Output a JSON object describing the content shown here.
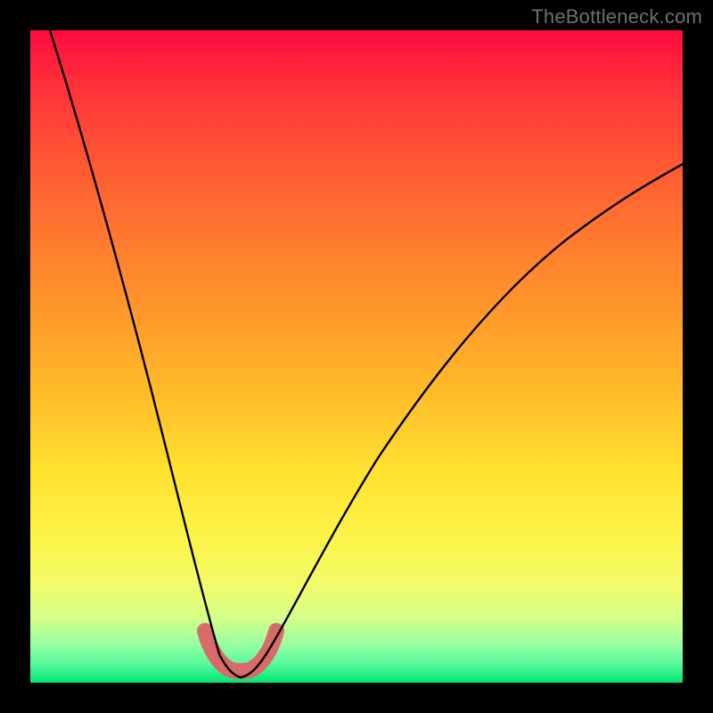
{
  "watermark": "TheBottleneck.com",
  "chart_data": {
    "type": "line",
    "title": "",
    "xlabel": "",
    "ylabel": "",
    "xlim": [
      0,
      100
    ],
    "ylim": [
      0,
      100
    ],
    "grid": false,
    "legend": false,
    "series": [
      {
        "name": "curve-left",
        "x": [
          0,
          4,
          8,
          12,
          15,
          18,
          21,
          23,
          25,
          27,
          28,
          29,
          30
        ],
        "y": [
          100,
          82,
          65,
          50,
          40,
          31,
          23,
          17,
          12,
          8,
          5,
          3,
          2
        ]
      },
      {
        "name": "curve-right",
        "x": [
          34,
          36,
          38,
          41,
          45,
          50,
          56,
          63,
          71,
          80,
          90,
          100
        ],
        "y": [
          2,
          5,
          10,
          17,
          26,
          36,
          46,
          56,
          64,
          71,
          76,
          80
        ]
      },
      {
        "name": "highlight-band",
        "x": [
          27,
          28,
          29,
          30,
          31,
          32,
          33,
          34,
          35,
          36
        ],
        "y": [
          8,
          5,
          3,
          2,
          1.5,
          1.5,
          2,
          3,
          5,
          8
        ]
      }
    ],
    "colors": {
      "curve": "#000000",
      "highlight": "#d86a6a",
      "gradient_top": "#ff0b3f",
      "gradient_bottom": "#00e676"
    },
    "notes": "V-shaped bottleneck curve over red-to-green vertical gradient; minimum near x≈31; pink rounded highlight over trough region."
  }
}
